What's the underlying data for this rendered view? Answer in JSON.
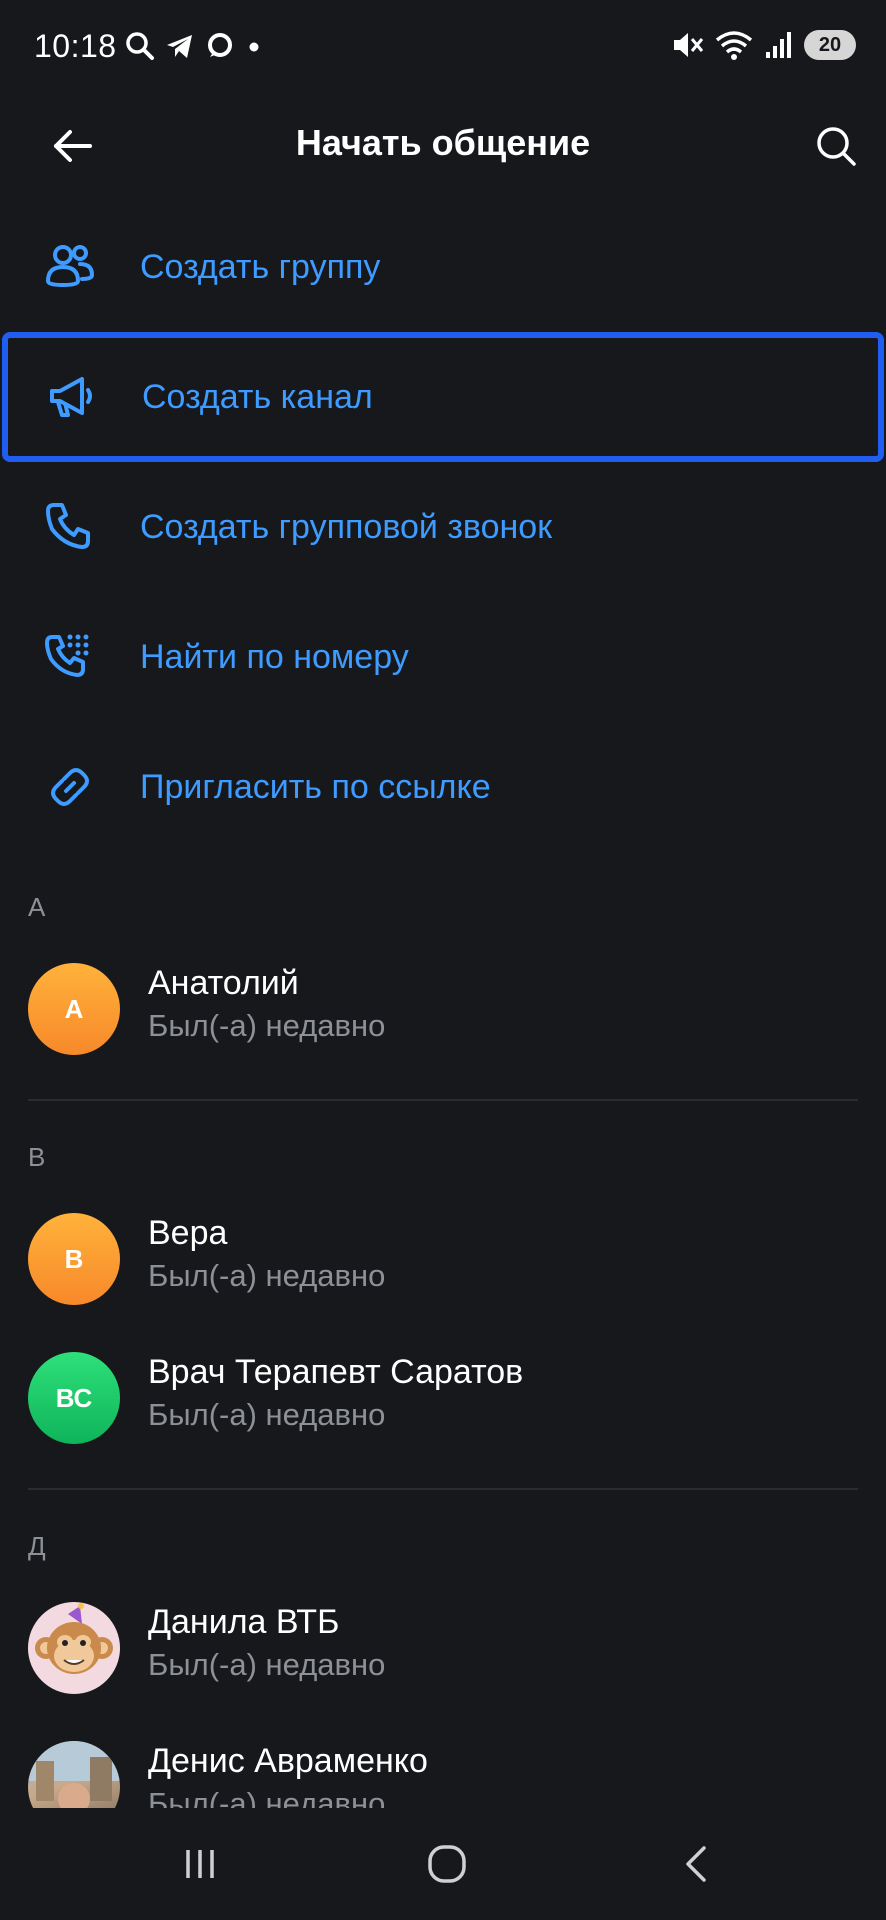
{
  "status_bar": {
    "time": "10:18",
    "battery": "20"
  },
  "app_bar": {
    "title": "Начать общение"
  },
  "menu": [
    {
      "label": "Создать группу",
      "icon": "group-icon"
    },
    {
      "label": "Создать канал",
      "icon": "megaphone-icon"
    },
    {
      "label": "Создать групповой звонок",
      "icon": "phone-icon"
    },
    {
      "label": "Найти по номеру",
      "icon": "dialpad-phone-icon"
    },
    {
      "label": "Пригласить по ссылке",
      "icon": "link-icon"
    }
  ],
  "sections": [
    {
      "letter": "А",
      "contacts": [
        {
          "name": "Анатолий",
          "status": "Был(-а) недавно",
          "initials": "А",
          "avatar": "orange"
        }
      ]
    },
    {
      "letter": "В",
      "contacts": [
        {
          "name": "Вера",
          "status": "Был(-а) недавно",
          "initials": "В",
          "avatar": "orange"
        },
        {
          "name": "Врач Терапевт Саратов",
          "status": "Был(-а) недавно",
          "initials": "ВС",
          "avatar": "green"
        }
      ]
    },
    {
      "letter": "Д",
      "contacts": [
        {
          "name": "Данила ВТБ",
          "status": "Был(-а) недавно",
          "initials": "",
          "avatar": "monkey"
        },
        {
          "name": "Денис Авраменко",
          "status": "Был(-а) недавно",
          "initials": "",
          "avatar": "photo"
        }
      ]
    }
  ],
  "colors": {
    "background": "#17181c",
    "accent": "#3e9bff",
    "focus_border": "#1f5ef0",
    "secondary_text": "#8d9096"
  }
}
